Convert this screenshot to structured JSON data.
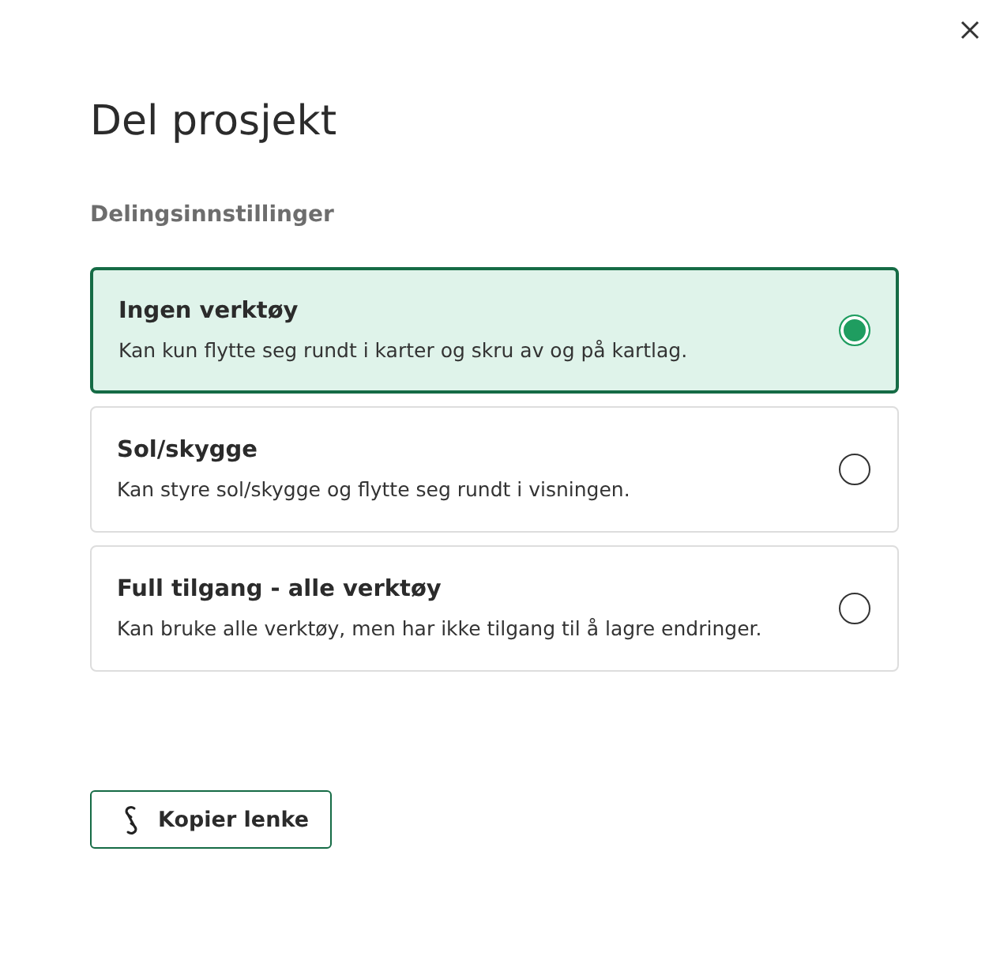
{
  "title": "Del prosjekt",
  "section_label": "Delingsinnstillinger",
  "options": [
    {
      "title": "Ingen verktøy",
      "description": "Kan kun flytte seg rundt i karter og skru av og på kartlag.",
      "selected": true
    },
    {
      "title": "Sol/skygge",
      "description": "Kan styre sol/skygge og flytte seg rundt i visningen.",
      "selected": false
    },
    {
      "title": "Full tilgang - alle verktøy",
      "description": "Kan bruke alle verktøy, men har ikke tilgang til å lagre endringer.",
      "selected": false
    }
  ],
  "copy_button": "Kopier lenke"
}
